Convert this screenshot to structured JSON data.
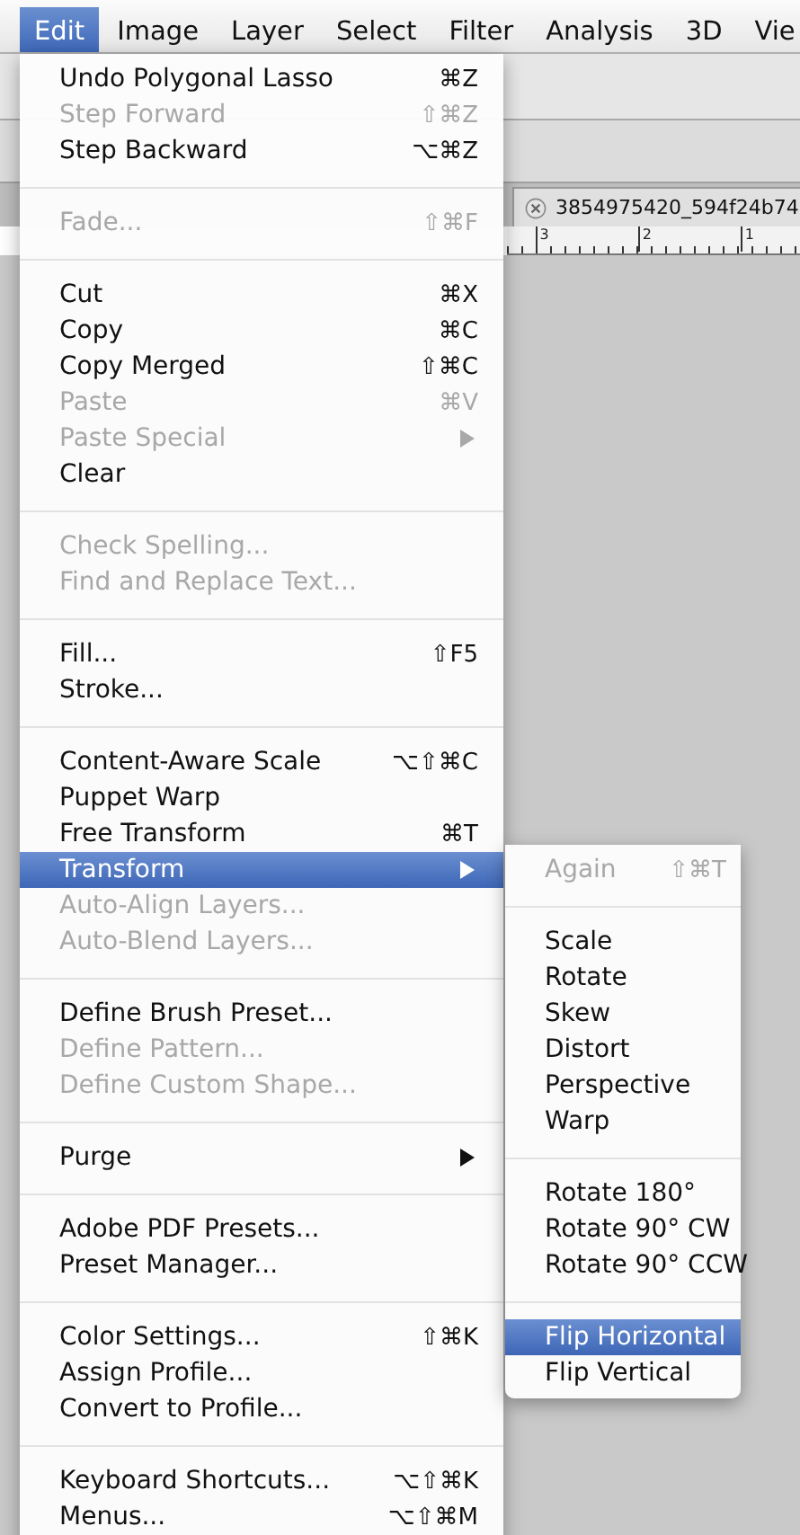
{
  "menubar": [
    {
      "label": "Edit",
      "selected": true
    },
    {
      "label": "Image",
      "selected": false
    },
    {
      "label": "Layer",
      "selected": false
    },
    {
      "label": "Select",
      "selected": false
    },
    {
      "label": "Filter",
      "selected": false
    },
    {
      "label": "Analysis",
      "selected": false
    },
    {
      "label": "3D",
      "selected": false
    },
    {
      "label": "Vie",
      "selected": false
    }
  ],
  "document": {
    "tab_title": "3854975420_594f24b74",
    "ruler_labels": [
      "3",
      "2",
      "1"
    ]
  },
  "edit_menu": {
    "groups": [
      [
        {
          "label": "Undo Polygonal Lasso",
          "shortcut": "⌘Z",
          "disabled": false,
          "selected": false
        },
        {
          "label": "Step Forward",
          "shortcut": "⇧⌘Z",
          "disabled": true,
          "selected": false
        },
        {
          "label": "Step Backward",
          "shortcut": "⌥⌘Z",
          "disabled": false,
          "selected": false
        }
      ],
      [
        {
          "label": "Fade...",
          "shortcut": "⇧⌘F",
          "disabled": true,
          "selected": false
        }
      ],
      [
        {
          "label": "Cut",
          "shortcut": "⌘X",
          "disabled": false,
          "selected": false
        },
        {
          "label": "Copy",
          "shortcut": "⌘C",
          "disabled": false,
          "selected": false
        },
        {
          "label": "Copy Merged",
          "shortcut": "⇧⌘C",
          "disabled": false,
          "selected": false
        },
        {
          "label": "Paste",
          "shortcut": "⌘V",
          "disabled": true,
          "selected": false
        },
        {
          "label": "Paste Special",
          "has_submenu": true,
          "disabled": true,
          "selected": false
        },
        {
          "label": "Clear",
          "disabled": false,
          "selected": false
        }
      ],
      [
        {
          "label": "Check Spelling...",
          "disabled": true,
          "selected": false
        },
        {
          "label": "Find and Replace Text...",
          "disabled": true,
          "selected": false
        }
      ],
      [
        {
          "label": "Fill...",
          "shortcut": "⇧F5",
          "disabled": false,
          "selected": false
        },
        {
          "label": "Stroke...",
          "disabled": false,
          "selected": false
        }
      ],
      [
        {
          "label": "Content-Aware Scale",
          "shortcut": "⌥⇧⌘C",
          "disabled": false,
          "selected": false
        },
        {
          "label": "Puppet Warp",
          "disabled": false,
          "selected": false
        },
        {
          "label": "Free Transform",
          "shortcut": "⌘T",
          "disabled": false,
          "selected": false
        },
        {
          "label": "Transform",
          "has_submenu": true,
          "disabled": false,
          "selected": true
        },
        {
          "label": "Auto-Align Layers...",
          "disabled": true,
          "selected": false
        },
        {
          "label": "Auto-Blend Layers...",
          "disabled": true,
          "selected": false
        }
      ],
      [
        {
          "label": "Define Brush Preset...",
          "disabled": false,
          "selected": false
        },
        {
          "label": "Define Pattern...",
          "disabled": true,
          "selected": false
        },
        {
          "label": "Define Custom Shape...",
          "disabled": true,
          "selected": false
        }
      ],
      [
        {
          "label": "Purge",
          "has_submenu": true,
          "disabled": false,
          "selected": false
        }
      ],
      [
        {
          "label": "Adobe PDF Presets...",
          "disabled": false,
          "selected": false
        },
        {
          "label": "Preset Manager...",
          "disabled": false,
          "selected": false
        }
      ],
      [
        {
          "label": "Color Settings...",
          "shortcut": "⇧⌘K",
          "disabled": false,
          "selected": false
        },
        {
          "label": "Assign Profile...",
          "disabled": false,
          "selected": false
        },
        {
          "label": "Convert to Profile...",
          "disabled": false,
          "selected": false
        }
      ],
      [
        {
          "label": "Keyboard Shortcuts...",
          "shortcut": "⌥⇧⌘K",
          "disabled": false,
          "selected": false
        },
        {
          "label": "Menus...",
          "shortcut": "⌥⇧⌘M",
          "disabled": false,
          "selected": false
        }
      ]
    ]
  },
  "transform_submenu": {
    "groups": [
      [
        {
          "label": "Again",
          "shortcut": "⇧⌘T",
          "disabled": true,
          "selected": false
        }
      ],
      [
        {
          "label": "Scale",
          "disabled": false,
          "selected": false
        },
        {
          "label": "Rotate",
          "disabled": false,
          "selected": false
        },
        {
          "label": "Skew",
          "disabled": false,
          "selected": false
        },
        {
          "label": "Distort",
          "disabled": false,
          "selected": false
        },
        {
          "label": "Perspective",
          "disabled": false,
          "selected": false
        },
        {
          "label": "Warp",
          "disabled": false,
          "selected": false
        }
      ],
      [
        {
          "label": "Rotate 180°",
          "disabled": false,
          "selected": false
        },
        {
          "label": "Rotate 90° CW",
          "disabled": false,
          "selected": false
        },
        {
          "label": "Rotate 90° CCW",
          "disabled": false,
          "selected": false
        }
      ],
      [
        {
          "label": "Flip Horizontal",
          "disabled": false,
          "selected": true
        },
        {
          "label": "Flip Vertical",
          "disabled": false,
          "selected": false
        }
      ]
    ]
  }
}
